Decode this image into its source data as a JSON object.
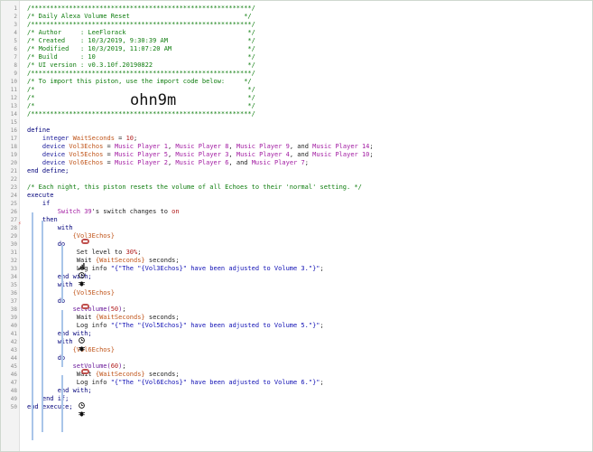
{
  "editor": {
    "lines": [
      {
        "n": "1",
        "segs": [
          {
            "c": "c",
            "t": "/**********************************************************/"
          }
        ]
      },
      {
        "n": "2",
        "segs": [
          {
            "c": "c",
            "t": "/* Daily Alexa Volume Reset                              */"
          }
        ]
      },
      {
        "n": "3",
        "segs": [
          {
            "c": "c",
            "t": "/**********************************************************/"
          }
        ]
      },
      {
        "n": "4",
        "segs": [
          {
            "c": "c",
            "t": "/* Author     : LeeFlorack                                */"
          }
        ]
      },
      {
        "n": "5",
        "segs": [
          {
            "c": "c",
            "t": "/* Created    : 10/3/2019, 9:30:39 AM                     */"
          }
        ]
      },
      {
        "n": "6",
        "segs": [
          {
            "c": "c",
            "t": "/* Modified   : 10/3/2019, 11:07:20 AM                    */"
          }
        ]
      },
      {
        "n": "7",
        "segs": [
          {
            "c": "c",
            "t": "/* Build      : 10                                        */"
          }
        ]
      },
      {
        "n": "8",
        "segs": [
          {
            "c": "c",
            "t": "/* UI version : v0.3.10f.20190822                         */"
          }
        ]
      },
      {
        "n": "9",
        "segs": [
          {
            "c": "c",
            "t": "/**********************************************************/"
          }
        ]
      },
      {
        "n": "10",
        "segs": [
          {
            "c": "c",
            "t": "/* To import this piston, use the import code below:     */"
          }
        ]
      },
      {
        "n": "11",
        "segs": [
          {
            "c": "c",
            "t": "/*                                                        */"
          }
        ]
      },
      {
        "n": "12",
        "segs": [
          {
            "c": "c",
            "t": "/*                                                        */"
          }
        ]
      },
      {
        "n": "13",
        "segs": [
          {
            "c": "c",
            "t": "/*                                                        */"
          }
        ]
      },
      {
        "n": "14",
        "segs": [
          {
            "c": "c",
            "t": "/**********************************************************/"
          }
        ]
      },
      {
        "n": "15",
        "segs": []
      },
      {
        "n": "16",
        "segs": [
          {
            "c": "kw",
            "t": "define"
          }
        ]
      },
      {
        "n": "17",
        "segs": [
          {
            "c": "tp",
            "t": "    integer "
          },
          {
            "c": "var",
            "t": "WaitSeconds"
          },
          {
            "c": "plain",
            "t": " = "
          },
          {
            "c": "num",
            "t": "10"
          },
          {
            "c": "plain",
            "t": ";"
          }
        ]
      },
      {
        "n": "18",
        "segs": [
          {
            "c": "tp",
            "t": "    device "
          },
          {
            "c": "var",
            "t": "Vol3Echos"
          },
          {
            "c": "plain",
            "t": " = "
          },
          {
            "c": "dev",
            "t": "Music Player 1"
          },
          {
            "c": "plain",
            "t": ", "
          },
          {
            "c": "dev",
            "t": "Music Player 8"
          },
          {
            "c": "plain",
            "t": ", "
          },
          {
            "c": "dev",
            "t": "Music Player 9"
          },
          {
            "c": "plain",
            "t": ", and "
          },
          {
            "c": "dev",
            "t": "Music Player 14"
          },
          {
            "c": "plain",
            "t": ";"
          }
        ]
      },
      {
        "n": "19",
        "segs": [
          {
            "c": "tp",
            "t": "    device "
          },
          {
            "c": "var",
            "t": "Vol5Echos"
          },
          {
            "c": "plain",
            "t": " = "
          },
          {
            "c": "dev",
            "t": "Music Player 5"
          },
          {
            "c": "plain",
            "t": ", "
          },
          {
            "c": "dev",
            "t": "Music Player 3"
          },
          {
            "c": "plain",
            "t": ", "
          },
          {
            "c": "dev",
            "t": "Music Player 4"
          },
          {
            "c": "plain",
            "t": ", and "
          },
          {
            "c": "dev",
            "t": "Music Player 10"
          },
          {
            "c": "plain",
            "t": ";"
          }
        ]
      },
      {
        "n": "20",
        "segs": [
          {
            "c": "tp",
            "t": "    device "
          },
          {
            "c": "var",
            "t": "Vol6Echos"
          },
          {
            "c": "plain",
            "t": " = "
          },
          {
            "c": "dev",
            "t": "Music Player 2"
          },
          {
            "c": "plain",
            "t": ", "
          },
          {
            "c": "dev",
            "t": "Music Player 6"
          },
          {
            "c": "plain",
            "t": ", and "
          },
          {
            "c": "dev",
            "t": "Music Player 7"
          },
          {
            "c": "plain",
            "t": ";"
          }
        ]
      },
      {
        "n": "21",
        "segs": [
          {
            "c": "kw",
            "t": "end define;"
          }
        ]
      },
      {
        "n": "22",
        "segs": []
      },
      {
        "n": "23",
        "segs": [
          {
            "c": "c",
            "t": "/* Each night, this piston resets the volume of all Echoes to their 'normal' setting. */"
          }
        ]
      },
      {
        "n": "24",
        "segs": [
          {
            "c": "kw",
            "t": "execute"
          }
        ]
      },
      {
        "n": "25",
        "segs": [
          {
            "c": "kw",
            "t": "    if"
          }
        ]
      },
      {
        "n": "26",
        "segs": [
          {
            "c": "dev",
            "t": "        Switch 39"
          },
          {
            "c": "plain",
            "t": "'s switch changes to "
          },
          {
            "c": "num",
            "t": "on"
          }
        ]
      },
      {
        "n": "27",
        "segs": [
          {
            "c": "kw",
            "t": "    then"
          }
        ]
      },
      {
        "n": "28",
        "segs": [
          {
            "c": "kw",
            "t": "        with "
          }
        ]
      },
      {
        "n": "29",
        "segs": [
          {
            "c": "var",
            "t": "            {Vol3Echos}"
          }
        ]
      },
      {
        "n": "30",
        "segs": [
          {
            "c": "kw",
            "t": "        do"
          }
        ]
      },
      {
        "n": "31",
        "segs": [
          {
            "c": "plain",
            "t": "             Set level to "
          },
          {
            "c": "num",
            "t": "30%"
          },
          {
            "c": "plain",
            "t": ";"
          }
        ]
      },
      {
        "n": "32",
        "segs": [
          {
            "c": "plain",
            "t": "             Wait "
          },
          {
            "c": "var",
            "t": "{WaitSeconds}"
          },
          {
            "c": "plain",
            "t": " seconds;"
          }
        ]
      },
      {
        "n": "33",
        "segs": [
          {
            "c": "plain",
            "t": "             Log info "
          },
          {
            "c": "str",
            "t": "\"{\"The \"{Vol3Echos}\" have been adjusted to Volume 3.\"}\""
          },
          {
            "c": "plain",
            "t": ";"
          }
        ]
      },
      {
        "n": "34",
        "segs": [
          {
            "c": "kw",
            "t": "        end with;"
          }
        ]
      },
      {
        "n": "35",
        "segs": [
          {
            "c": "kw",
            "t": "        with "
          }
        ]
      },
      {
        "n": "36",
        "segs": [
          {
            "c": "var",
            "t": "            {Vol5Echos}"
          }
        ]
      },
      {
        "n": "37",
        "segs": [
          {
            "c": "kw",
            "t": "        do"
          }
        ]
      },
      {
        "n": "38",
        "segs": [
          {
            "c": "fn",
            "t": "            setVolume("
          },
          {
            "c": "num",
            "t": "50"
          },
          {
            "c": "fn",
            "t": ")"
          },
          {
            "c": "plain",
            "t": ";"
          }
        ]
      },
      {
        "n": "39",
        "segs": [
          {
            "c": "plain",
            "t": "             Wait "
          },
          {
            "c": "var",
            "t": "{WaitSeconds}"
          },
          {
            "c": "plain",
            "t": " seconds;"
          }
        ]
      },
      {
        "n": "40",
        "segs": [
          {
            "c": "plain",
            "t": "             Log info "
          },
          {
            "c": "str",
            "t": "\"{\"The \"{Vol5Echos}\" have been adjusted to Volume 5.\"}\""
          },
          {
            "c": "plain",
            "t": ";"
          }
        ]
      },
      {
        "n": "41",
        "segs": [
          {
            "c": "kw",
            "t": "        end with;"
          }
        ]
      },
      {
        "n": "42",
        "segs": [
          {
            "c": "kw",
            "t": "        with "
          }
        ]
      },
      {
        "n": "43",
        "segs": [
          {
            "c": "var",
            "t": "            {Vol6Echos}"
          }
        ]
      },
      {
        "n": "44",
        "segs": [
          {
            "c": "kw",
            "t": "        do"
          }
        ]
      },
      {
        "n": "45",
        "segs": [
          {
            "c": "fn",
            "t": "            setVolume("
          },
          {
            "c": "num",
            "t": "60"
          },
          {
            "c": "fn",
            "t": ")"
          },
          {
            "c": "plain",
            "t": ";"
          }
        ]
      },
      {
        "n": "46",
        "segs": [
          {
            "c": "plain",
            "t": "             Wait "
          },
          {
            "c": "var",
            "t": "{WaitSeconds}"
          },
          {
            "c": "plain",
            "t": " seconds;"
          }
        ]
      },
      {
        "n": "47",
        "segs": [
          {
            "c": "plain",
            "t": "             Log info "
          },
          {
            "c": "str",
            "t": "\"{\"The \"{Vol6Echos}\" have been adjusted to Volume 6.\"}\""
          },
          {
            "c": "plain",
            "t": ";"
          }
        ]
      },
      {
        "n": "48",
        "segs": [
          {
            "c": "kw",
            "t": "        end with;"
          }
        ]
      },
      {
        "n": "49",
        "segs": [
          {
            "c": "kw",
            "t": "    end if;"
          }
        ]
      },
      {
        "n": "50",
        "segs": [
          {
            "c": "kw",
            "t": "end execute;"
          }
        ]
      }
    ],
    "import_code": "ohn9m",
    "trigger_marker": "⚡"
  }
}
